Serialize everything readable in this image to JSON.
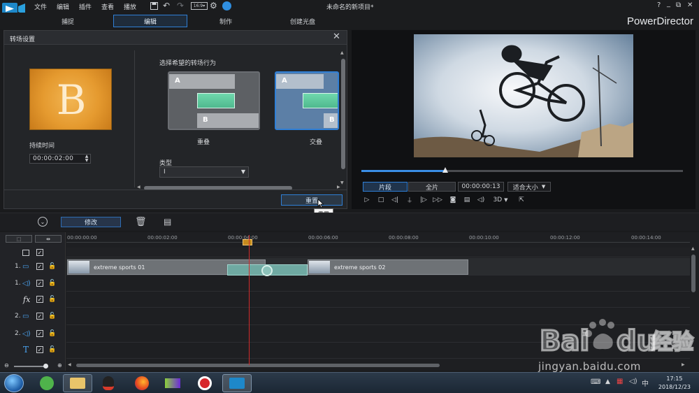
{
  "menu": {
    "items": [
      "文件",
      "编辑",
      "插件",
      "查看",
      "播放"
    ],
    "project_title": "未命名的新项目*",
    "brand": "PowerDirector",
    "window_controls": [
      "?",
      "_",
      "⧉",
      "✕"
    ]
  },
  "mode_tabs": {
    "capture": "捕捉",
    "edit": "编辑",
    "produce": "制作",
    "create_disc": "创建光盘"
  },
  "transition_panel": {
    "title": "转场设置",
    "preview_letter": "B",
    "duration_label": "持续时间",
    "duration_value": "00:00:02:00",
    "behavior_label": "选择希望的转场行为",
    "options": [
      {
        "label": "重叠",
        "a": "A",
        "b": "B"
      },
      {
        "label": "交叠",
        "a": "A",
        "b": "B"
      }
    ],
    "type_label": "类型",
    "type_value": "I",
    "reset_button": "重置",
    "tooltip": "重置"
  },
  "preview": {
    "clip_tab": "片段",
    "full_tab": "全片",
    "timecode": "00:00:00:13",
    "fit_label": "适合大小",
    "mode_3d": "3D",
    "seek_progress": 0.26
  },
  "toolbar": {
    "modify": "修改"
  },
  "timeline": {
    "ruler_ticks": [
      "00:00:00:00",
      "00:00:02:00",
      "00:00:04:00",
      "00:00:06:00",
      "00:00:08:00",
      "00:00:10:00",
      "00:00:12:00",
      "00:00:14:00"
    ],
    "tracks": [
      {
        "num": "1.",
        "kind": "video"
      },
      {
        "num": "1.",
        "kind": "audio"
      },
      {
        "num": "",
        "kind": "fx"
      },
      {
        "num": "2.",
        "kind": "video"
      },
      {
        "num": "2.",
        "kind": "audio"
      },
      {
        "num": "",
        "kind": "title"
      }
    ],
    "clips": [
      {
        "name": "extreme sports 01"
      },
      {
        "name": "extreme sports 02"
      }
    ]
  },
  "taskbar": {
    "time": "17:15",
    "date": "2018/12/23"
  },
  "watermark": {
    "logo": "Bai du 经验",
    "url": "jingyan.baidu.com"
  },
  "colors": {
    "accent_blue": "#2f7fd6",
    "transition_green": "#5fcaa0",
    "playhead_red": "#d12b2b"
  }
}
